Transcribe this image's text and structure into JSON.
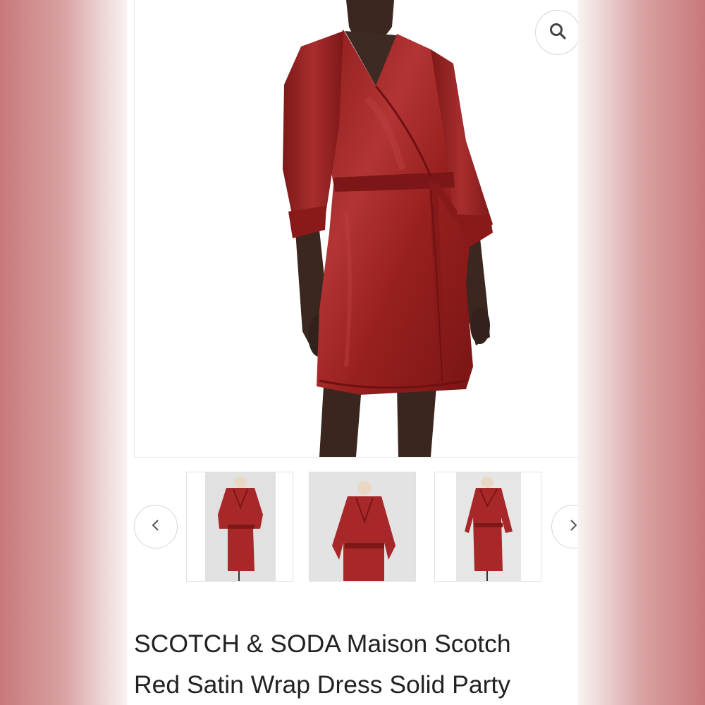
{
  "product": {
    "title_line_1": "SCOTCH & SODA Maison Scotch",
    "title_line_2": "Red Satin Wrap Dress Solid Party"
  },
  "gallery": {
    "main_image": "model-wearing-red-satin-wrap-dress",
    "thumbnails": [
      {
        "image": "dress-on-mannequin-front"
      },
      {
        "image": "dress-on-mannequin-front-close"
      },
      {
        "image": "dress-on-mannequin-side"
      }
    ]
  },
  "icons": {
    "zoom": "search-icon",
    "prev": "chevron-left-icon",
    "next": "chevron-right-icon"
  },
  "colors": {
    "dress_red": "#9e2424",
    "background_blush": "#d9a2a3",
    "title_text": "#222222"
  }
}
